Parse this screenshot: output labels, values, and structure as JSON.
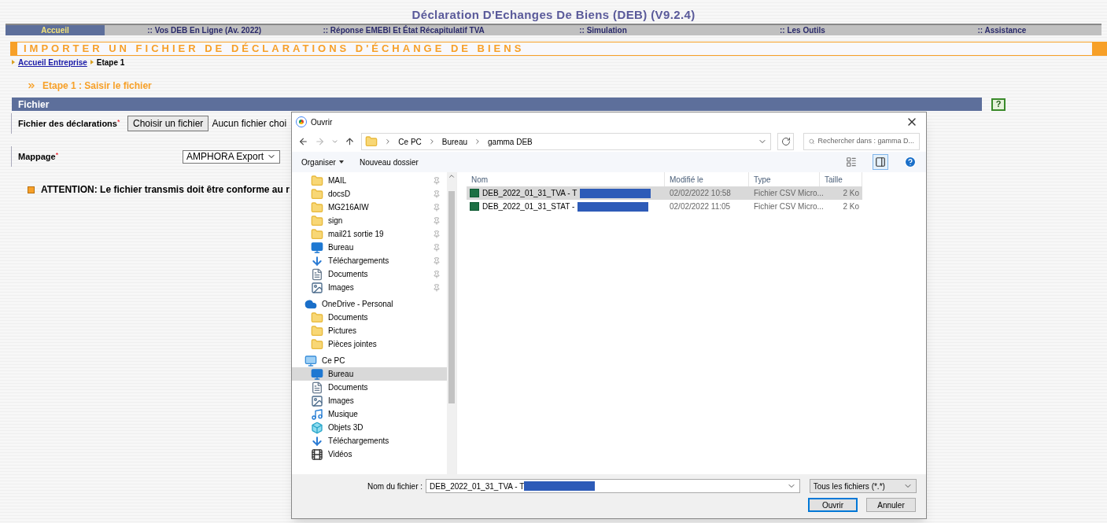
{
  "app_title": "Déclaration D'Echanges De Biens (DEB) (V9.2.4)",
  "menu": [
    {
      "label": "Accueil",
      "selected": true
    },
    {
      "label": ":: Vos DEB En Ligne (Av. 2022)",
      "selected": false
    },
    {
      "label": ":: Réponse EMEBI Et État Récapitulatif TVA",
      "selected": false
    },
    {
      "label": ":: Simulation",
      "selected": false
    },
    {
      "label": ":: Les Outils",
      "selected": false
    },
    {
      "label": ":: Assistance",
      "selected": false
    }
  ],
  "page_title": "IMPORTER UN FICHIER DE DÉCLARATIONS D'ÉCHANGE DE BIENS",
  "breadcrumb": {
    "link": "Accueil Entreprise",
    "current": "Etape 1"
  },
  "step": "Etape 1 : Saisir le fichier",
  "section": {
    "title": "Fichier",
    "help": "?"
  },
  "file_field": {
    "label": "Fichier des déclarations",
    "required_mark": "*",
    "button": "Choisir un fichier",
    "status": "Aucun fichier choi"
  },
  "mapping": {
    "label": "Mappage",
    "required_mark": "*",
    "value": "AMPHORA Export"
  },
  "warning": "ATTENTION: Le fichier transmis doit être conforme au r",
  "dialog": {
    "title": "Ouvrir",
    "path": [
      "Ce PC",
      "Bureau",
      "gamma DEB"
    ],
    "search_placeholder": "Rechercher dans : gamma D...",
    "toolbar": [
      "Organiser",
      "Nouveau dossier"
    ],
    "nav": [
      {
        "items": [
          {
            "label": "MAIL",
            "kind": "folder",
            "pinned": true,
            "selected": false
          },
          {
            "label": "docsD",
            "kind": "folder",
            "pinned": true,
            "selected": false
          },
          {
            "label": "MG216AIW",
            "kind": "folder",
            "pinned": true,
            "selected": false
          },
          {
            "label": "sign",
            "kind": "folder",
            "pinned": true,
            "selected": false
          },
          {
            "label": "mail21 sortie 19",
            "kind": "folder",
            "pinned": true,
            "selected": false
          },
          {
            "label": "Bureau",
            "kind": "desktop",
            "pinned": true,
            "selected": false
          },
          {
            "label": "Téléchargements",
            "kind": "download",
            "pinned": true,
            "selected": false
          },
          {
            "label": "Documents",
            "kind": "document",
            "pinned": true,
            "selected": false
          },
          {
            "label": "Images",
            "kind": "images",
            "pinned": true,
            "selected": false
          }
        ]
      },
      {
        "label": "OneDrive - Personal",
        "kind": "cloud",
        "items": [
          {
            "label": "Documents",
            "kind": "folder",
            "pinned": false,
            "selected": false
          },
          {
            "label": "Pictures",
            "kind": "folder",
            "pinned": false,
            "selected": false
          },
          {
            "label": "Pièces jointes",
            "kind": "folder",
            "pinned": false,
            "selected": false
          }
        ]
      },
      {
        "label": "Ce PC",
        "kind": "pc",
        "items": [
          {
            "label": "Bureau",
            "kind": "desktop",
            "pinned": false,
            "selected": true
          },
          {
            "label": "Documents",
            "kind": "document",
            "pinned": false,
            "selected": false
          },
          {
            "label": "Images",
            "kind": "images",
            "pinned": false,
            "selected": false
          },
          {
            "label": "Musique",
            "kind": "music",
            "pinned": false,
            "selected": false
          },
          {
            "label": "Objets 3D",
            "kind": "cube",
            "pinned": false,
            "selected": false
          },
          {
            "label": "Téléchargements",
            "kind": "download",
            "pinned": false,
            "selected": false
          },
          {
            "label": "Vidéos",
            "kind": "video",
            "pinned": false,
            "selected": false
          }
        ]
      }
    ],
    "columns": [
      "Nom",
      "Modifié le",
      "Type",
      "Taille"
    ],
    "files": [
      {
        "name": "DEB_2022_01_31_TVA - T",
        "redacted": true,
        "modified": "02/02/2022 10:58",
        "type": "Fichier CSV Micro...",
        "size": "2 Ko",
        "selected": true
      },
      {
        "name": "DEB_2022_01_31_STAT -",
        "redacted": true,
        "modified": "02/02/2022 11:05",
        "type": "Fichier CSV Micro...",
        "size": "2 Ko",
        "selected": false
      }
    ],
    "filename_label": "Nom du fichier :",
    "filename_value": "DEB_2022_01_31_TVA - T",
    "filename_redacted": true,
    "filter": "Tous les fichiers (*.*)",
    "buttons": [
      "Ouvrir",
      "Annuler"
    ]
  }
}
